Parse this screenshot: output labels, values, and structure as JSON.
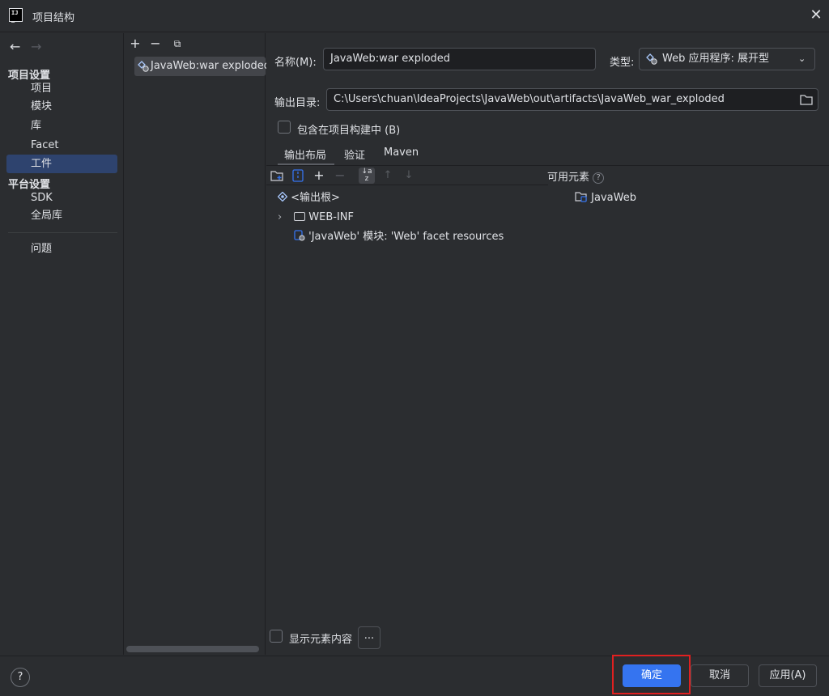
{
  "window": {
    "title": "项目结构",
    "close_glyph": "✕"
  },
  "nav": {
    "back_glyph": "←",
    "forward_glyph": "→",
    "project_settings_header": "项目设置",
    "platform_settings_header": "平台设置",
    "items": {
      "project": "项目",
      "modules": "模块",
      "libraries": "库",
      "facets": "Facet",
      "artifacts": "工件",
      "sdks": "SDK",
      "global_libraries": "全局库",
      "problems": "问题"
    },
    "selected": "工件"
  },
  "artifacts_toolbar": {
    "add_glyph": "+",
    "remove_glyph": "−",
    "copy_glyph": "⧉"
  },
  "artifacts": [
    {
      "label": "JavaWeb:war exploded"
    }
  ],
  "form": {
    "name_label": "名称(M):",
    "name_value": "JavaWeb:war exploded",
    "type_label": "类型:",
    "type_value": "Web 应用程序: 展开型",
    "output_dir_label": "输出目录:",
    "output_dir_value": "C:\\Users\\chuan\\IdeaProjects\\JavaWeb\\out\\artifacts\\JavaWeb_war_exploded",
    "include_in_build_label": "包含在项目构建中 (B)",
    "include_in_build_checked": false
  },
  "tabs": {
    "output_layout": "输出布局",
    "validation": "验证",
    "maven": "Maven",
    "selected": "输出布局"
  },
  "layout_toolbar": {
    "plus": "+",
    "minus": "−",
    "sort": "↓a z",
    "up": "↑",
    "down": "↓"
  },
  "available_elements": {
    "label": "可用元素",
    "help_glyph": "?",
    "items": [
      "JavaWeb"
    ]
  },
  "tree": {
    "root": "<输出根>",
    "children": [
      {
        "label": "WEB-INF",
        "expandable": true
      },
      {
        "label": "'JavaWeb' 模块: 'Web' facet resources",
        "expandable": false
      }
    ]
  },
  "show_content": {
    "label": "显示元素内容",
    "checked": false,
    "more_button": "..."
  },
  "buttons": {
    "ok": "确定",
    "cancel": "取消",
    "apply": "应用(A)",
    "help": "?"
  },
  "colors": {
    "accent": "#3574f0",
    "selection": "#2e436e",
    "highlight_box": "#e02020"
  }
}
